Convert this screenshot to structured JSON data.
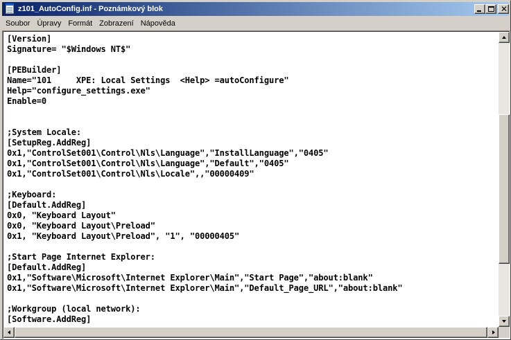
{
  "window": {
    "title": "z101_AutoConfig.inf - Poznámkový blok"
  },
  "menu": [
    "Soubor",
    "Úpravy",
    "Formát",
    "Zobrazení",
    "Nápověda"
  ],
  "document": {
    "lines": [
      "[Version]",
      "Signature= \"$Windows NT$\"",
      "",
      "[PEBuilder]",
      "Name=\"101     XPE: Local Settings  <Help> =autoConfigure\"",
      "Help=\"configure_settings.exe\"",
      "Enable=0",
      "",
      "",
      ";System Locale:",
      "[SetupReg.AddReg]",
      "0x1,\"ControlSet001\\Control\\Nls\\Language\",\"InstallLanguage\",\"0405\"",
      "0x1,\"ControlSet001\\Control\\Nls\\Language\",\"Default\",\"0405\"",
      "0x1,\"ControlSet001\\Control\\Nls\\Locale\",,\"00000409\"",
      "",
      ";Keyboard:",
      "[Default.AddReg]",
      "0x0, \"Keyboard Layout\"",
      "0x0, \"Keyboard Layout\\Preload\"",
      "0x1, \"Keyboard Layout\\Preload\", \"1\", \"00000405\"",
      "",
      ";Start Page Internet Explorer:",
      "[Default.AddReg]",
      "0x1,\"Software\\Microsoft\\Internet Explorer\\Main\",\"Start Page\",\"about:blank\"",
      "0x1,\"Software\\Microsoft\\Internet Explorer\\Main\",\"Default_Page_URL\",\"about:blank\"",
      "",
      ";Workgroup (local network):",
      "[Software.AddReg]"
    ]
  },
  "colors": {
    "titlebar_start": "#0a246a",
    "titlebar_end": "#a6caf0",
    "chrome": "#d4d0c8"
  },
  "icons": {
    "app": "notepad-icon",
    "minimize": "minimize-icon",
    "maximize": "maximize-icon",
    "close": "close-icon"
  }
}
